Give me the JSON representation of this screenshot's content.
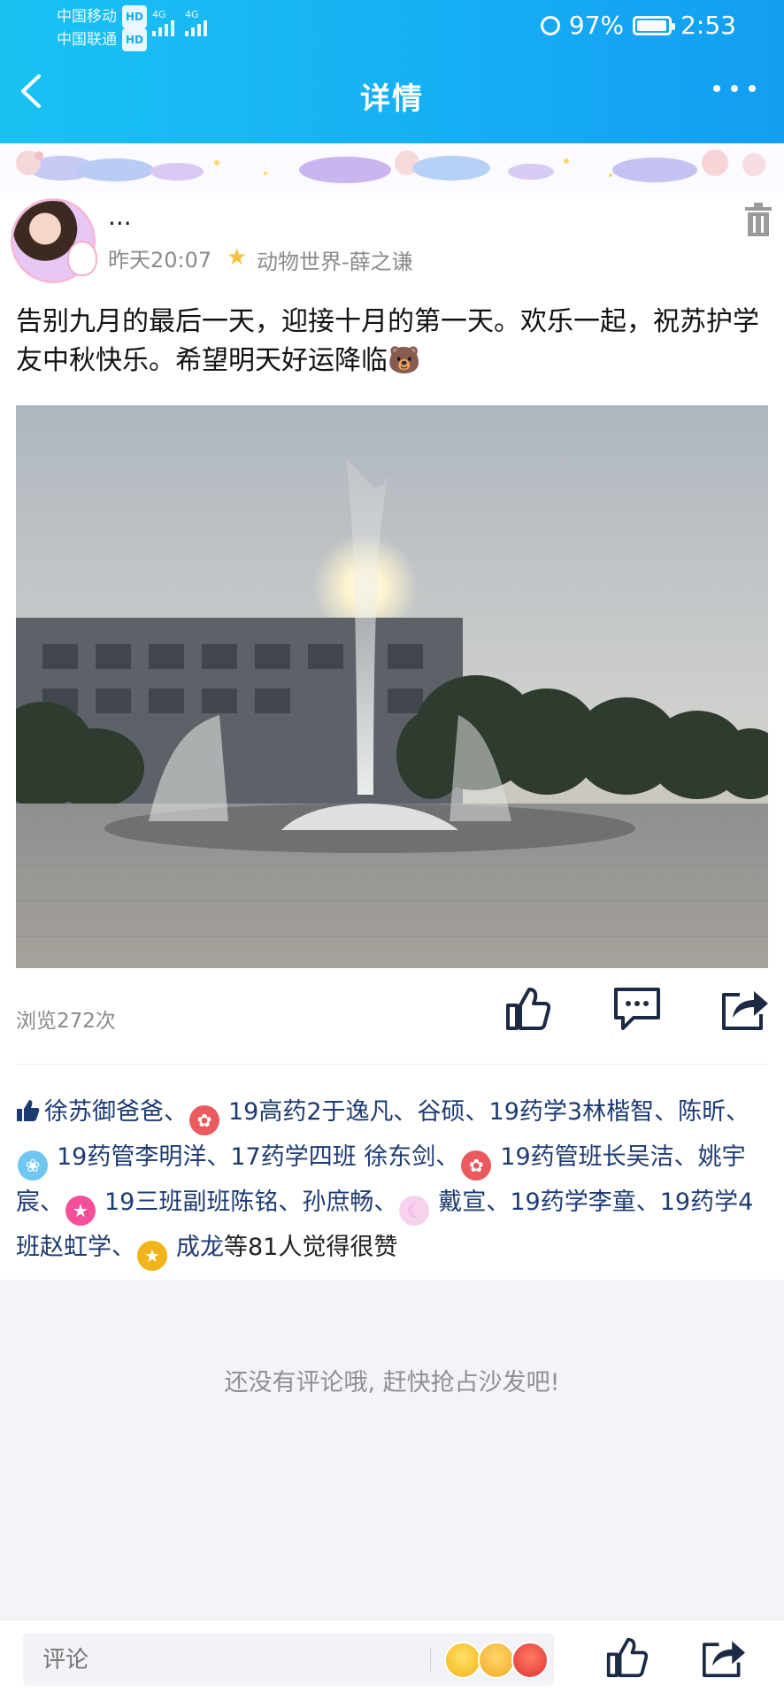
{
  "status": {
    "carrier1": "中国移动",
    "carrier2": "中国联通",
    "hd": "HD",
    "net": "4G",
    "battery": "97%",
    "time": "2:53"
  },
  "header": {
    "title": "详情"
  },
  "post": {
    "nickname": "...",
    "time": "昨天20:07",
    "topic": "动物世界-薛之谦",
    "text": "告别九月的最后一天，迎接十月的第一天。欢乐一起，祝苏护学友中秋快乐。希望明天好运降临🐻",
    "views": "浏览272次"
  },
  "likes": {
    "l1": "徐苏御爸爸、",
    "l2": "19高药2于逸凡、谷硕、19药学3林楷智、陈昕、",
    "l3": "19药管李明洋、17药学四班 徐东剑、",
    "l4": "19药管班长吴洁、姚宇宸、",
    "l5": "19三班副班陈铭、孙庶畅、",
    "l6": "戴宣、19药学李童、19药学4班赵虹学、",
    "l7": "成龙",
    "summary": "等81人觉得很赞"
  },
  "comments": {
    "empty": "还没有评论哦, 赶快抢占沙发吧!"
  },
  "bottom": {
    "placeholder": "评论"
  },
  "colors": {
    "header": "#17b3f4",
    "like_text": "#1d3b73"
  }
}
